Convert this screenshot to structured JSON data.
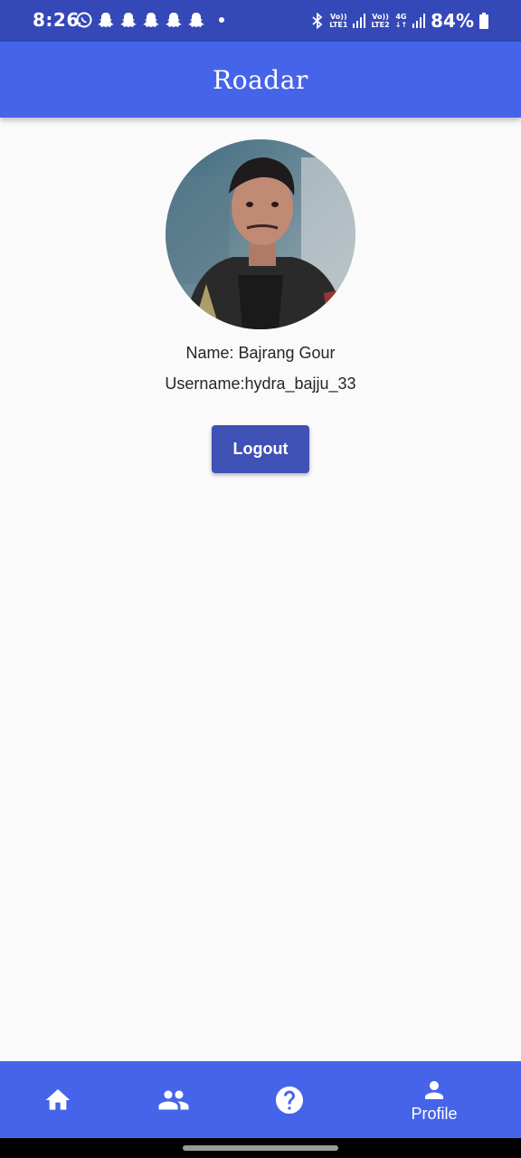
{
  "status_bar": {
    "time": "8:26",
    "network1": [
      "Vo))",
      "LTE1"
    ],
    "network2": [
      "Vo))",
      "LTE2"
    ],
    "network3": "4G",
    "battery": "84%"
  },
  "app_bar": {
    "title": "Roadar"
  },
  "profile": {
    "name_line": "Name: Bajrang Gour",
    "username_line": "Username:hydra_bajju_33",
    "logout_label": "Logout"
  },
  "bottom_nav": {
    "items": [
      {
        "icon": "home-icon",
        "label": ""
      },
      {
        "icon": "people-icon",
        "label": ""
      },
      {
        "icon": "help-icon",
        "label": ""
      },
      {
        "icon": "person-icon",
        "label": "Profile"
      }
    ]
  },
  "colors": {
    "status_bar": "#3548b8",
    "primary": "#4664ea",
    "button": "#3f51b5",
    "background": "#fafafa"
  }
}
